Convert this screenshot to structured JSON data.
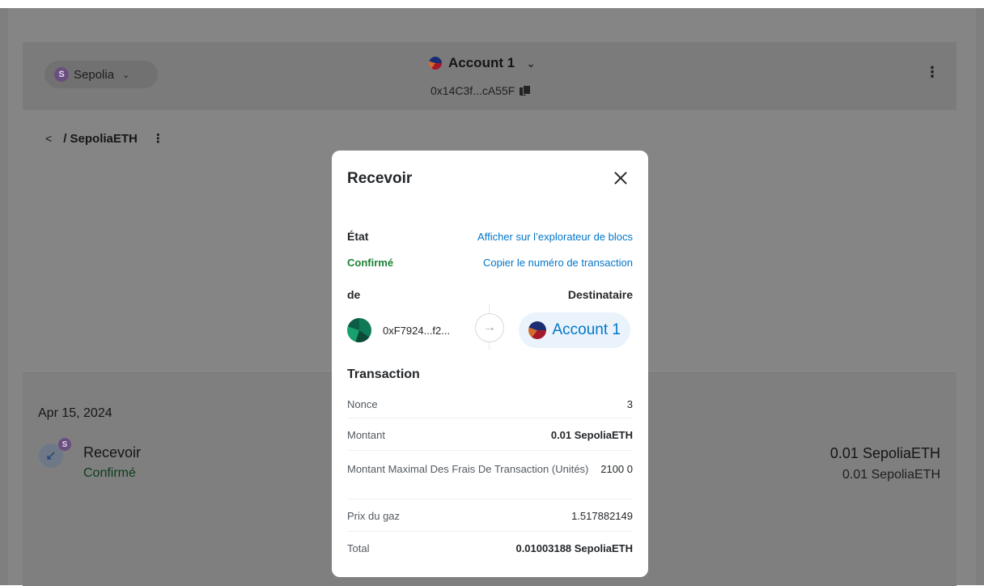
{
  "header": {
    "network": {
      "badge": "S",
      "name": "Sepolia"
    },
    "account": {
      "name": "Account 1",
      "address": "0x14C3f...cA55F"
    }
  },
  "asset": {
    "breadcrumb": "/ SepoliaETH"
  },
  "activity": {
    "date": "Apr 15, 2024",
    "item": {
      "badge": "S",
      "title": "Recevoir",
      "status": "Confirmé",
      "amount": "0.01 SepoliaETH",
      "sub_amount": "0.01 SepoliaETH"
    }
  },
  "modal": {
    "title": "Recevoir",
    "state_label": "État",
    "state_value": "Confirmé",
    "link_explorer": "Afficher sur l’explorateur de blocs",
    "link_copy_tx": "Copier le numéro de transaction",
    "from_label": "de",
    "to_label": "Destinataire",
    "from_address": "0xF7924...f2...",
    "to_account": "Account 1",
    "transaction_label": "Transaction",
    "details": [
      {
        "label": "Nonce",
        "value": "3"
      },
      {
        "label": "Montant",
        "value": "0.01 SepoliaETH"
      },
      {
        "label": "Montant Maximal Des Frais De Transaction (Unités)",
        "value": "2100 0"
      },
      {
        "label": "Prix du gaz",
        "value": "1.517882149"
      },
      {
        "label": "Total",
        "value": "0.01003188 SepoliaETH"
      }
    ]
  },
  "colors": {
    "link": "#0376c9",
    "success": "#1c8234",
    "overlay": "#7f7f80"
  }
}
